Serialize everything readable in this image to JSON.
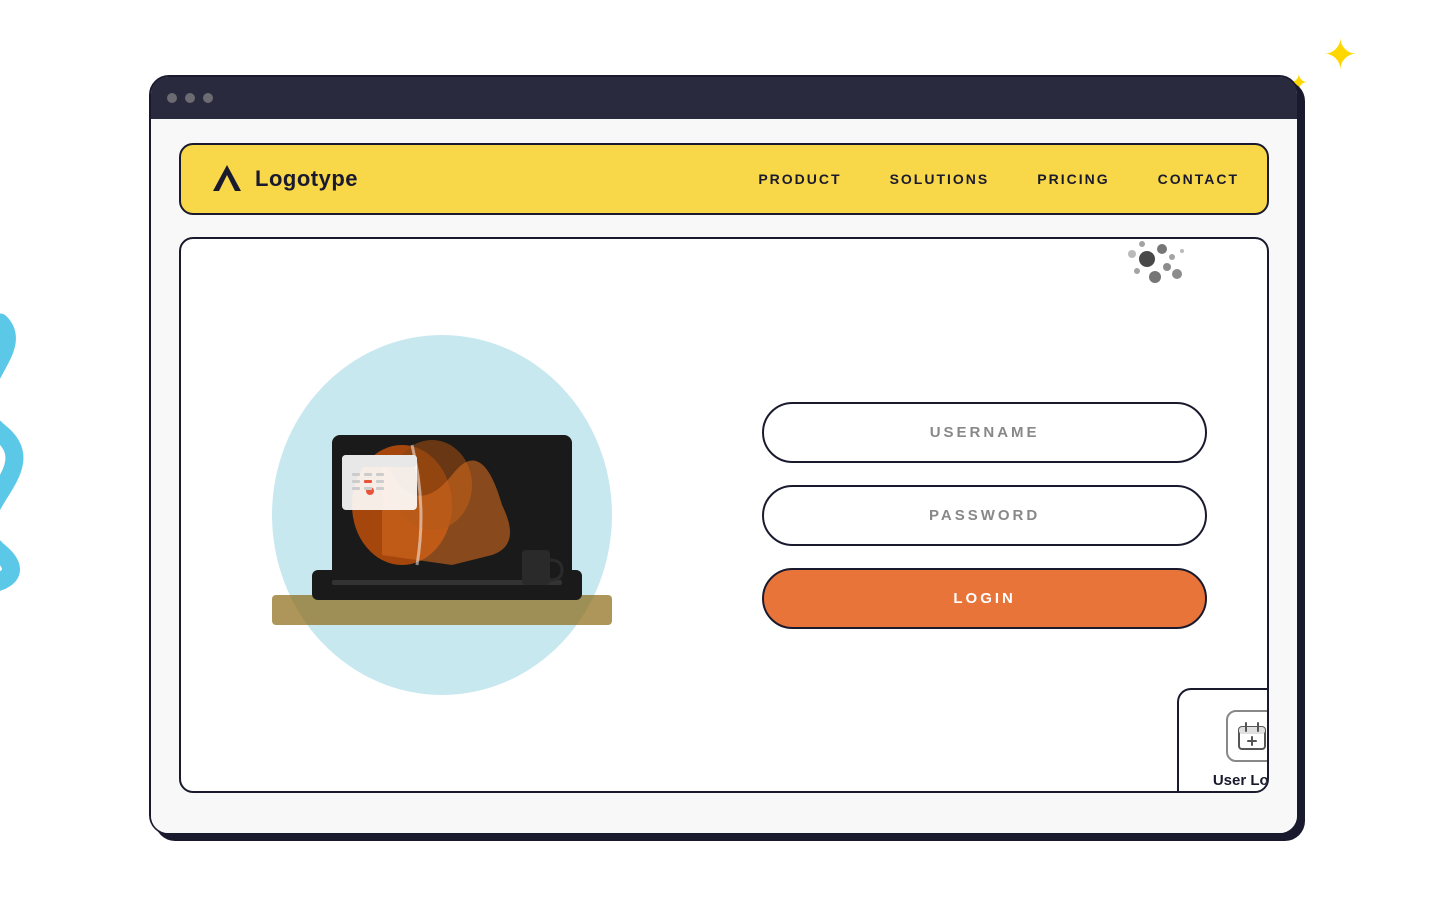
{
  "browser": {
    "dots": [
      "dot1",
      "dot2",
      "dot3"
    ]
  },
  "navbar": {
    "logo_text": "Logotype",
    "nav_items": [
      {
        "id": "product",
        "label": "PRODUCT"
      },
      {
        "id": "solutions",
        "label": "SOLUTIONS"
      },
      {
        "id": "pricing",
        "label": "PRICING"
      },
      {
        "id": "contact",
        "label": "CONTACT"
      }
    ]
  },
  "form": {
    "username_placeholder": "USERNAME",
    "password_placeholder": "PASSWORD",
    "login_label": "LOGIN"
  },
  "floating_card": {
    "label": "User Login"
  },
  "decorations": {
    "star_large": "✦",
    "star_small": "✦"
  }
}
